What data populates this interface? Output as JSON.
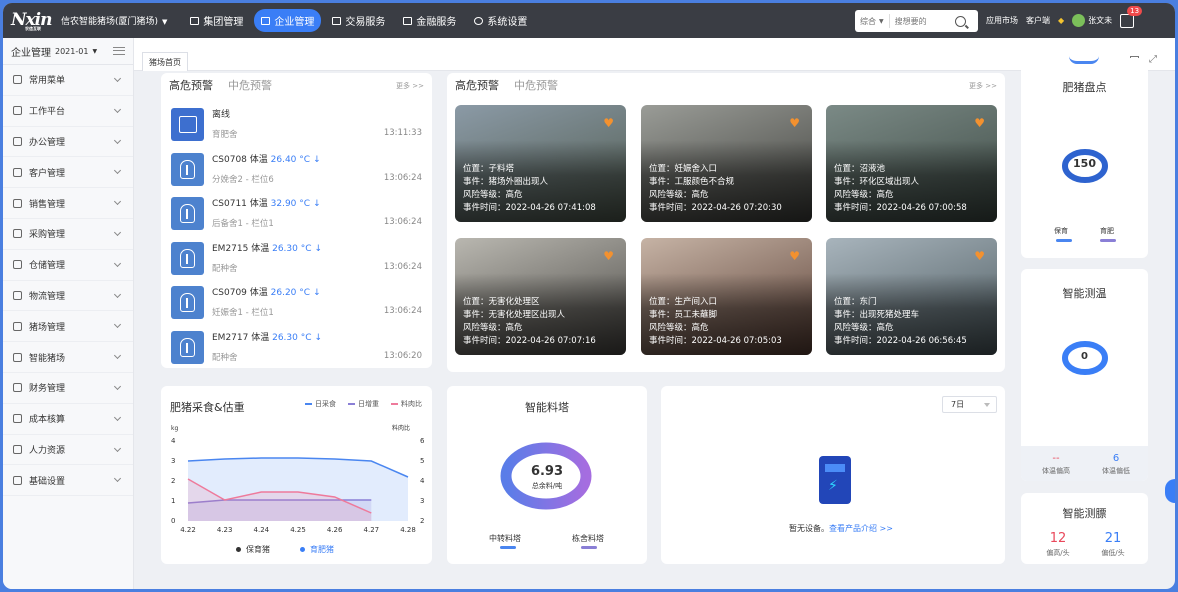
{
  "brand": {
    "logo_text": "Nxin",
    "logo_sub": "农信互联",
    "company": "信农智能猪场(厦门猪场)"
  },
  "nav": [
    {
      "label": "集团管理",
      "active": false
    },
    {
      "label": "企业管理",
      "active": true
    },
    {
      "label": "交易服务",
      "active": false
    },
    {
      "label": "金融服务",
      "active": false
    },
    {
      "label": "系统设置",
      "active": false
    }
  ],
  "search": {
    "type": "综合",
    "placeholder": "搜想要的"
  },
  "top_right": {
    "app_market": "应用市场",
    "client": "客户端",
    "user": "张文未",
    "notifications": "13"
  },
  "sidebar": {
    "title": "企业管理",
    "date": "2021-01",
    "items": [
      "常用菜单",
      "工作平台",
      "办公管理",
      "客户管理",
      "销售管理",
      "采购管理",
      "仓储管理",
      "物流管理",
      "猪场管理",
      "智能猪场",
      "财务管理",
      "成本核算",
      "人力资源",
      "基础设置"
    ]
  },
  "tabs": {
    "home": "猪场首页"
  },
  "alerts_left": {
    "tab_high": "高危预警",
    "tab_mid": "中危预警",
    "more": "更多 >>",
    "items": [
      {
        "title": "离线",
        "value": "",
        "sub": "育肥舍",
        "time": "13:11:33",
        "icon": "offline-device-icon"
      },
      {
        "title": "CS0708 体温",
        "value": "26.40 °C",
        "sub": "分娩舍2 - 栏位6",
        "time": "13:06:24",
        "icon": "thermometer-icon"
      },
      {
        "title": "CS0711 体温",
        "value": "32.90 °C",
        "sub": "后备舍1 - 栏位1",
        "time": "13:06:24",
        "icon": "thermometer-icon"
      },
      {
        "title": "EM2715 体温",
        "value": "26.30 °C",
        "sub": "配种舍",
        "time": "13:06:24",
        "icon": "thermometer-icon"
      },
      {
        "title": "CS0709 体温",
        "value": "26.20 °C",
        "sub": "妊娠舍1 - 栏位1",
        "time": "13:06:24",
        "icon": "thermometer-icon"
      },
      {
        "title": "EM2717 体温",
        "value": "26.30 °C",
        "sub": "配种舍",
        "time": "13:06:20",
        "icon": "thermometer-icon"
      }
    ],
    "arrow": "↓"
  },
  "alerts_photos": {
    "tab_high": "高危预警",
    "tab_mid": "中危预警",
    "more": "更多 >>",
    "items": [
      {
        "l1": "位置：子料塔",
        "l2": "事件：猪场外圈出现人",
        "l3": "风险等级：高危",
        "l4": "事件时间：2022-04-26 07:41:08",
        "c1": "#8b9aa6",
        "c2": "#4f5a4e"
      },
      {
        "l1": "位置：妊娠舍入口",
        "l2": "事件：工服颜色不合规",
        "l3": "风险等级：高危",
        "l4": "事件时间：2022-04-26 07:20:30",
        "c1": "#9a9c97",
        "c2": "#3e3f3b"
      },
      {
        "l1": "位置：沼液池",
        "l2": "事件：环化区域出现人",
        "l3": "风险等级：高危",
        "l4": "事件时间：2022-04-26 07:00:58",
        "c1": "#7b8a86",
        "c2": "#3d4a44"
      },
      {
        "l1": "位置：无害化处理区",
        "l2": "事件：无害化处理区出现人",
        "l3": "风险等级：高危",
        "l4": "事件时间：2022-04-26 07:07:16",
        "c1": "#b9b7b0",
        "c2": "#4a4844"
      },
      {
        "l1": "位置：生产间入口",
        "l2": "事件：员工未蘸脚",
        "l3": "风险等级：高危",
        "l4": "事件时间：2022-04-26 07:05:03",
        "c1": "#c6b3a5",
        "c2": "#5a3f35"
      },
      {
        "l1": "位置：东门",
        "l2": "事件：出现死猪处理车",
        "l3": "风险等级：高危",
        "l4": "事件时间：2022-04-26 06:56:45",
        "c1": "#a8b4bc",
        "c2": "#4c5a5f"
      }
    ]
  },
  "feed_chart": {
    "title": "肥猪采食&估重",
    "legend": [
      "日采食",
      "日增重",
      "料肉比"
    ],
    "bottom_legend": [
      "保育猪",
      "育肥猪"
    ]
  },
  "chart_data": {
    "type": "area",
    "title": "肥猪采食&估重",
    "categories": [
      "4.22",
      "4.23",
      "4.24",
      "4.25",
      "4.26",
      "4.27",
      "4.28"
    ],
    "ylabel_left": "kg",
    "ylabel_right": "料肉比",
    "ylim_left": [
      0,
      4
    ],
    "ylim_right": [
      2,
      6
    ],
    "yticks_left": [
      "0",
      "1",
      "2",
      "3",
      "4"
    ],
    "yticks_right": [
      "2",
      "3",
      "4",
      "5",
      "6"
    ],
    "series": [
      {
        "name": "日采食",
        "color": "#4a86f0",
        "axis": "left",
        "values": [
          3.0,
          3.1,
          3.15,
          3.15,
          3.1,
          3.0,
          2.2
        ]
      },
      {
        "name": "日增重",
        "color": "#8a7fd6",
        "axis": "left",
        "values": [
          0.9,
          1.05,
          1.05,
          1.05,
          1.05,
          1.05,
          null
        ]
      },
      {
        "name": "料肉比",
        "color": "#ee7a9b",
        "axis": "left",
        "values": [
          2.1,
          1.05,
          1.45,
          1.45,
          1.2,
          0.4,
          null
        ]
      }
    ],
    "legend": [
      "日采食",
      "日增重",
      "料肉比"
    ]
  },
  "feed_tower": {
    "title": "智能料塔",
    "value": "6.93",
    "unit": "总余料/吨",
    "bar1": "中转料塔",
    "bar2": "栋舍料塔"
  },
  "device_panel": {
    "select": "7日",
    "no_device": "暂无设备。",
    "link": "查看产品介绍 >>"
  },
  "fat_pig": {
    "title": "肥猪盘点",
    "value": "150",
    "label1": "保育",
    "label2": "育肥"
  },
  "temp": {
    "title": "智能测温",
    "value": "0",
    "v1": "--",
    "l1": "体温偏高",
    "v2": "6",
    "l2": "体温偏低"
  },
  "backfat": {
    "title": "智能测膘",
    "v1": "12",
    "l1": "偏高/头",
    "v2": "21",
    "l2": "偏低/头"
  },
  "colors": {
    "accent": "#3a7ef6",
    "topbar": "#3a3d44",
    "danger": "#e9485b",
    "heart": "#f3912f"
  }
}
